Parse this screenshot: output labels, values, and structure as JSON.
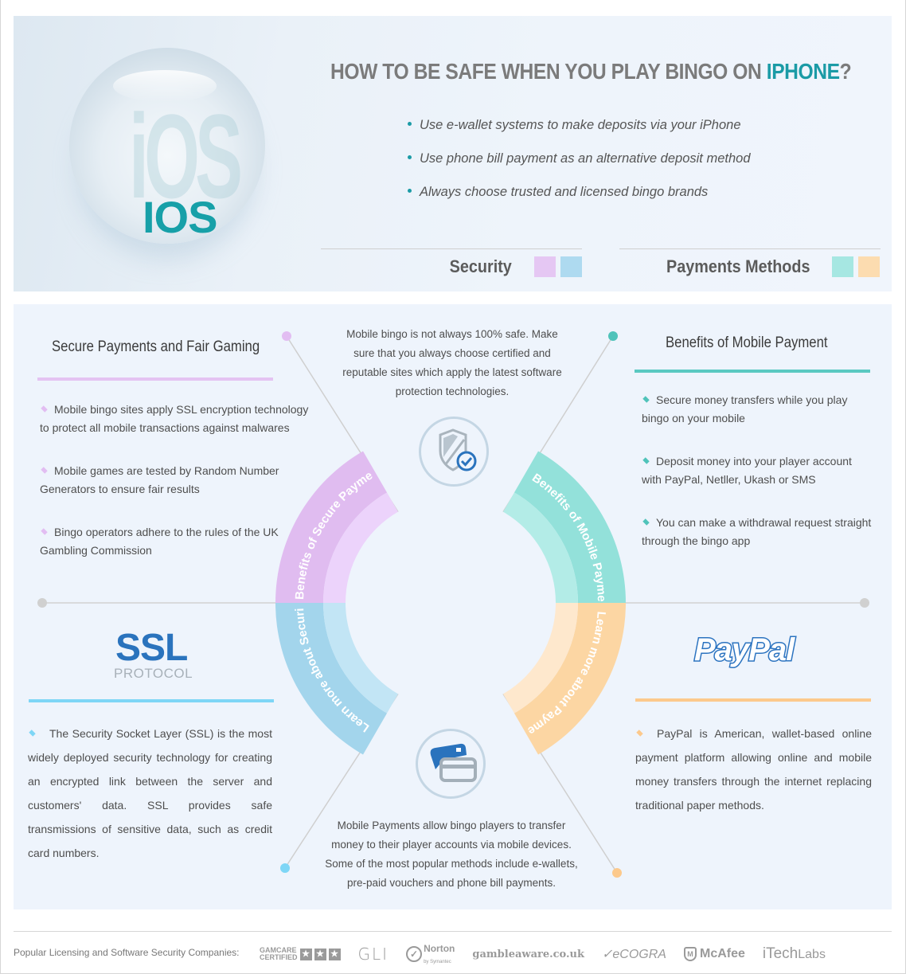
{
  "hero": {
    "orb_label": "IOS",
    "title_prefix": "HOW TO BE SAFE WHEN YOU PLAY BINGO ON ",
    "title_accent": "IPHONE",
    "title_suffix": "?",
    "tips": [
      "Use e-wallet systems to make deposits via your iPhone",
      "Use phone bill payment as an alternative deposit method",
      "Always choose trusted and licensed bingo brands"
    ],
    "legend": [
      {
        "label": "Security",
        "colors": [
          "#e5c7f3",
          "#aedaf0"
        ]
      },
      {
        "label": "Payments Methods",
        "colors": [
          "#a6e7e2",
          "#fcdcb0"
        ]
      }
    ]
  },
  "colors": {
    "accent": "#1b9ba6",
    "security_purple": "#e0bcf0",
    "security_purple_light": "#ecd3fb",
    "security_blue": "#a3d5ec",
    "security_blue_light": "#c2e5f5",
    "payment_teal": "#93e1da",
    "payment_teal_light": "#b3ece7",
    "payment_orange": "#fcd6a3",
    "payment_orange_light": "#fee8cd",
    "ssl_blue": "#2a73bd",
    "paypal_blue": "#2b73c0"
  },
  "secure_payments": {
    "title": "Secure Payments and Fair Gaming",
    "items": [
      "Mobile bingo sites apply SSL encryption technology to protect all mobile transactions against malwares",
      "Mobile games are tested by Random Number Generators to ensure fair results",
      "Bingo operators adhere to the rules of the UK Gambling Commission"
    ]
  },
  "center_top_text": "Mobile bingo is not always 100% safe. Make sure that you always choose certified and reputable sites which apply the latest software protection technologies.",
  "center_bottom_text": "Mobile Payments allow bingo players to transfer money to their player accounts via mobile devices. Some of the most popular methods include e-wallets, pre-paid vouchers and phone bill payments.",
  "mobile_payment": {
    "title": "Benefits of Mobile Payment",
    "items": [
      "Secure money transfers while you play bingo on your mobile",
      "Deposit money into your player account with PayPal, Netller, Ukash or SMS",
      "You can make a withdrawal request straight through the bingo app"
    ]
  },
  "ring_labels": {
    "top_left": "Benefits of Secure Payments",
    "top_right": "Benefits of Mobile Payment",
    "bottom_left": "Learn more about Security",
    "bottom_right": "Learn more about Payment"
  },
  "ssl": {
    "logo": "SSL",
    "sub": "PROTOCOL",
    "text": "The Security Socket Layer (SSL) is the most widely deployed security technology for creating an encrypted link between the server and customers' data. SSL provides safe transmissions of sensitive data, such as credit card numbers."
  },
  "paypal": {
    "logo": "PayPal",
    "text": "PayPal is American, wallet-based online payment platform allowing online and mobile money transfers through the internet replacing traditional paper methods."
  },
  "footer": {
    "label": "Popular Licensing and  Software Security Companies:",
    "logos": {
      "gamcare_top": "GAMCARE",
      "gamcare_bottom": "CERTIFIED",
      "gli": "GLI",
      "norton": "Norton",
      "norton_sub": "by Symantec",
      "gambleaware": "gambleaware.co.uk",
      "ecogra": "eCOGRA",
      "mcafee": "McAfee",
      "itech": "iTech",
      "itech_labs": "Labs"
    }
  }
}
